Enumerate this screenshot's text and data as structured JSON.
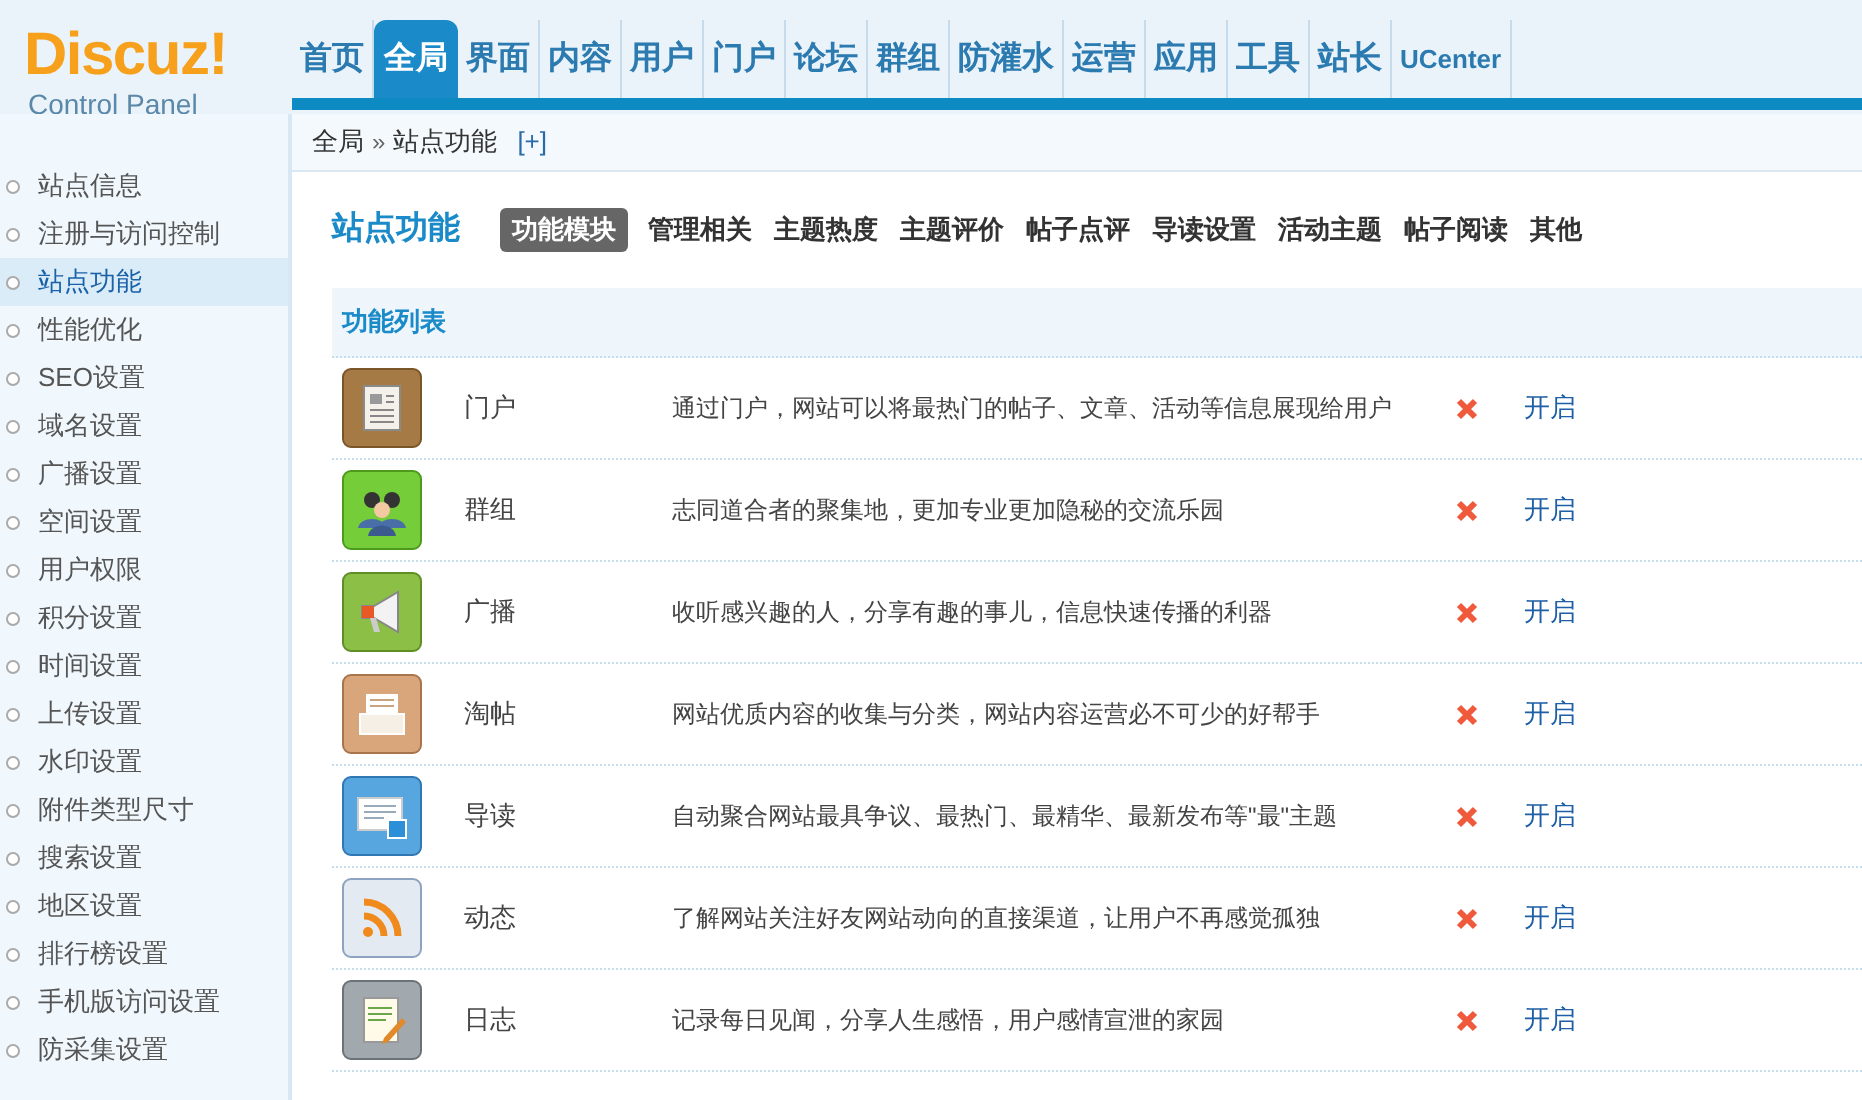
{
  "logo": {
    "title": "Discuz!",
    "subtitle": "Control Panel"
  },
  "nav": [
    {
      "label": "首页",
      "selected": false
    },
    {
      "label": "全局",
      "selected": true
    },
    {
      "label": "界面",
      "selected": false
    },
    {
      "label": "内容",
      "selected": false
    },
    {
      "label": "用户",
      "selected": false
    },
    {
      "label": "门户",
      "selected": false
    },
    {
      "label": "论坛",
      "selected": false
    },
    {
      "label": "群组",
      "selected": false
    },
    {
      "label": "防灌水",
      "selected": false
    },
    {
      "label": "运营",
      "selected": false
    },
    {
      "label": "应用",
      "selected": false
    },
    {
      "label": "工具",
      "selected": false
    },
    {
      "label": "站长",
      "selected": false
    },
    {
      "label": "UCenter",
      "selected": false
    }
  ],
  "breadcrumb": {
    "items": [
      "全局",
      "站点功能"
    ],
    "separator": "»",
    "expand": "[+]"
  },
  "sidebar": {
    "items": [
      {
        "label": "站点信息",
        "selected": false
      },
      {
        "label": "注册与访问控制",
        "selected": false
      },
      {
        "label": "站点功能",
        "selected": true
      },
      {
        "label": "性能优化",
        "selected": false
      },
      {
        "label": "SEO设置",
        "selected": false
      },
      {
        "label": "域名设置",
        "selected": false
      },
      {
        "label": "广播设置",
        "selected": false
      },
      {
        "label": "空间设置",
        "selected": false
      },
      {
        "label": "用户权限",
        "selected": false
      },
      {
        "label": "积分设置",
        "selected": false
      },
      {
        "label": "时间设置",
        "selected": false
      },
      {
        "label": "上传设置",
        "selected": false
      },
      {
        "label": "水印设置",
        "selected": false
      },
      {
        "label": "附件类型尺寸",
        "selected": false
      },
      {
        "label": "搜索设置",
        "selected": false
      },
      {
        "label": "地区设置",
        "selected": false
      },
      {
        "label": "排行榜设置",
        "selected": false
      },
      {
        "label": "手机版访问设置",
        "selected": false
      },
      {
        "label": "防采集设置",
        "selected": false
      }
    ]
  },
  "page_title": "站点功能",
  "tabs": [
    {
      "label": "功能模块",
      "selected": true
    },
    {
      "label": "管理相关",
      "selected": false
    },
    {
      "label": "主题热度",
      "selected": false
    },
    {
      "label": "主题评价",
      "selected": false
    },
    {
      "label": "帖子点评",
      "selected": false
    },
    {
      "label": "导读设置",
      "selected": false
    },
    {
      "label": "活动主题",
      "selected": false
    },
    {
      "label": "帖子阅读",
      "selected": false
    },
    {
      "label": "其他",
      "selected": false
    }
  ],
  "section_title": "功能列表",
  "modules": [
    {
      "kind": "portal",
      "name": "门户",
      "description": "通过门户，网站可以将最热门的帖子、文章、活动等信息展现给用户",
      "enabled": false,
      "action": "开启"
    },
    {
      "kind": "group",
      "name": "群组",
      "description": "志同道合者的聚集地，更加专业更加隐秘的交流乐园",
      "enabled": false,
      "action": "开启"
    },
    {
      "kind": "broadcast",
      "name": "广播",
      "description": "收听感兴趣的人，分享有趣的事儿，信息快速传播的利器",
      "enabled": false,
      "action": "开启"
    },
    {
      "kind": "collection",
      "name": "淘帖",
      "description": "网站优质内容的收集与分类，网站内容运营必不可少的好帮手",
      "enabled": false,
      "action": "开启"
    },
    {
      "kind": "guide",
      "name": "导读",
      "description": "自动聚合网站最具争议、最热门、最精华、最新发布等\"最\"主题",
      "enabled": false,
      "action": "开启"
    },
    {
      "kind": "feed",
      "name": "动态",
      "description": "了解网站关注好友网站动向的直接渠道，让用户不再感觉孤独",
      "enabled": false,
      "action": "开启"
    },
    {
      "kind": "blog",
      "name": "日志",
      "description": "记录每日见闻，分享人生感悟，用户感情宣泄的家园",
      "enabled": false,
      "action": "开启"
    }
  ]
}
